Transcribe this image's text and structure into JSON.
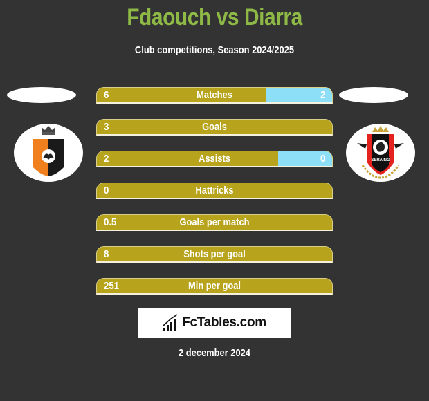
{
  "header": {
    "title": "Fdaouch vs Diarra",
    "subtitle": "Club competitions, Season 2024/2025"
  },
  "players": {
    "left": {
      "name": "Fdaouch",
      "club_logo": "deinze-crest-icon"
    },
    "right": {
      "name": "Diarra",
      "club_logo": "seraing-crest-icon",
      "logo_text": "SERAING"
    }
  },
  "colors": {
    "title": "#8fb946",
    "left_bar": "#b8a31c",
    "right_bar": "#8ddff7",
    "background": "#333333"
  },
  "stats": [
    {
      "label": "Matches",
      "left": "6",
      "right": "2",
      "left_fraction": 0.72
    },
    {
      "label": "Goals",
      "left": "3",
      "right": "",
      "left_fraction": 1.0
    },
    {
      "label": "Assists",
      "left": "2",
      "right": "0",
      "left_fraction": 0.77
    },
    {
      "label": "Hattricks",
      "left": "0",
      "right": "",
      "left_fraction": 1.0
    },
    {
      "label": "Goals per match",
      "left": "0.5",
      "right": "",
      "left_fraction": 1.0
    },
    {
      "label": "Shots per goal",
      "left": "8",
      "right": "",
      "left_fraction": 1.0
    },
    {
      "label": "Min per goal",
      "left": "251",
      "right": "",
      "left_fraction": 1.0
    }
  ],
  "brand": {
    "name": "FcTables.com",
    "icon": "bar-chart-icon"
  },
  "footer": {
    "date": "2 december 2024"
  }
}
